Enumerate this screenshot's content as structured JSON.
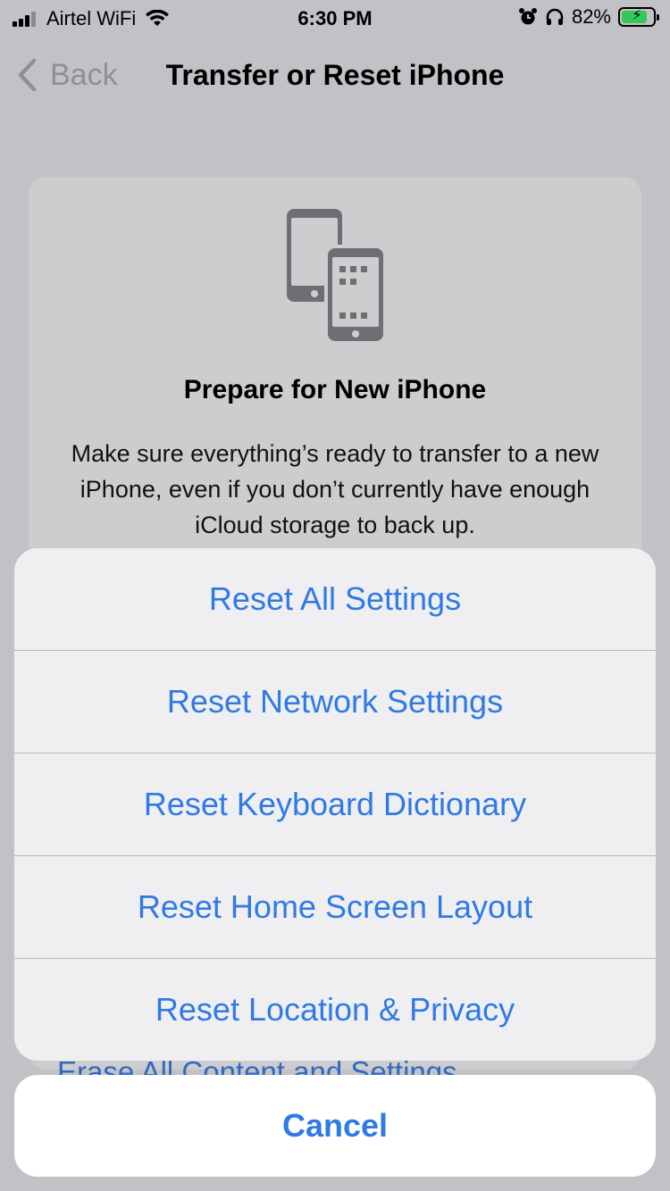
{
  "status_bar": {
    "carrier": "Airtel WiFi",
    "time": "6:30 PM",
    "battery": "82%",
    "battery_level": 0.82,
    "icons": [
      "signal-icon",
      "wifi-icon",
      "alarm-icon",
      "headphones-icon",
      "battery-charging-icon"
    ]
  },
  "nav": {
    "back_label": "Back",
    "title": "Transfer or Reset iPhone"
  },
  "card": {
    "icon": "transfer-phones-icon",
    "heading": "Prepare for New iPhone",
    "description": "Make sure everything’s ready to transfer to a new iPhone, even if you don’t currently have enough iCloud storage to back up.",
    "erase_label": "Erase All Content and Settings"
  },
  "action_sheet": {
    "items": [
      "Reset All Settings",
      "Reset Network Settings",
      "Reset Keyboard Dictionary",
      "Reset Home Screen Layout",
      "Reset Location & Privacy"
    ],
    "cancel_label": "Cancel"
  },
  "colors": {
    "accent": "#2f7ae5",
    "battery_charging": "#34c759"
  }
}
